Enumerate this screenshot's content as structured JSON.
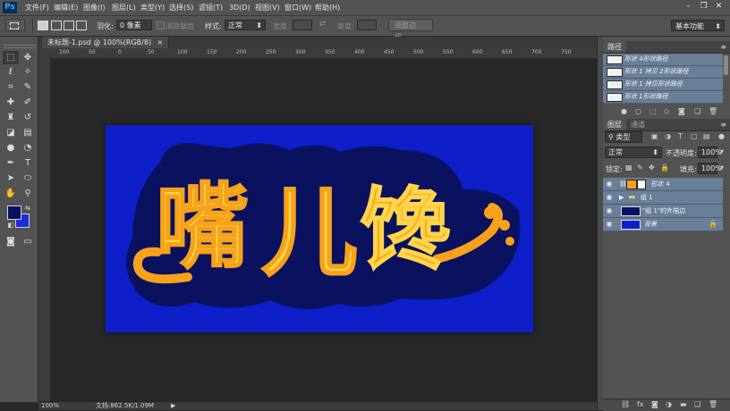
{
  "app": {
    "logo": "Ps"
  },
  "menu": [
    "文件(F)",
    "编辑(E)",
    "图像(I)",
    "图层(L)",
    "类型(Y)",
    "选择(S)",
    "滤镜(T)",
    "3D(D)",
    "视图(V)",
    "窗口(W)",
    "帮助(H)"
  ],
  "window_controls": {
    "minimize": "–",
    "restore": "❐",
    "close": "✕"
  },
  "options": {
    "feather_label": "羽化:",
    "feather_value": "0 像素",
    "antialias_label": "消除锯齿",
    "style_label": "样式:",
    "style_value": "正常",
    "width_label": "宽度:",
    "height_label": "高度:",
    "refine_edge": "调整边缘...",
    "workspace": "基本功能"
  },
  "document": {
    "tab_title": "未标题-1.psd @ 100%(RGB/8)",
    "close_mark": "×",
    "ruler_ticks": [
      "100",
      "50",
      "0",
      "50",
      "100",
      "150",
      "200",
      "250",
      "300",
      "350",
      "400",
      "450",
      "500",
      "550",
      "600",
      "650",
      "700",
      "750"
    ],
    "artwork_text": [
      "嘴",
      "儿",
      "馋"
    ]
  },
  "status": {
    "zoom": "100%",
    "doc_info": "文档:862.5K/1.09M",
    "arrow": "▶"
  },
  "paths_panel": {
    "title": "路径",
    "items": [
      "形状 4形状路径",
      "形状 1 拷贝 2形状路径",
      "形状 1 拷贝形状路径",
      "形状 1形状路径"
    ]
  },
  "layers_panel": {
    "tabs": [
      "图层",
      "通道"
    ],
    "filter_kind": "类型",
    "blend_mode": "正常",
    "opacity_label": "不透明度:",
    "opacity_value": "100%",
    "lock_label": "锁定:",
    "fill_label": "填充:",
    "fill_value": "100%",
    "layers": [
      {
        "name": "形状 4"
      },
      {
        "name": "组 1"
      },
      {
        "name": "\"组 1\"的外描边"
      },
      {
        "name": "背景"
      }
    ]
  },
  "colors": {
    "artboard_blue": "#0c1fc8",
    "text_yellow": "#ffd54a",
    "text_orange": "#f7a21a",
    "outline_navy": "#0a1260",
    "selected_row": "#6a7e98",
    "panel_gray": "#535353"
  }
}
